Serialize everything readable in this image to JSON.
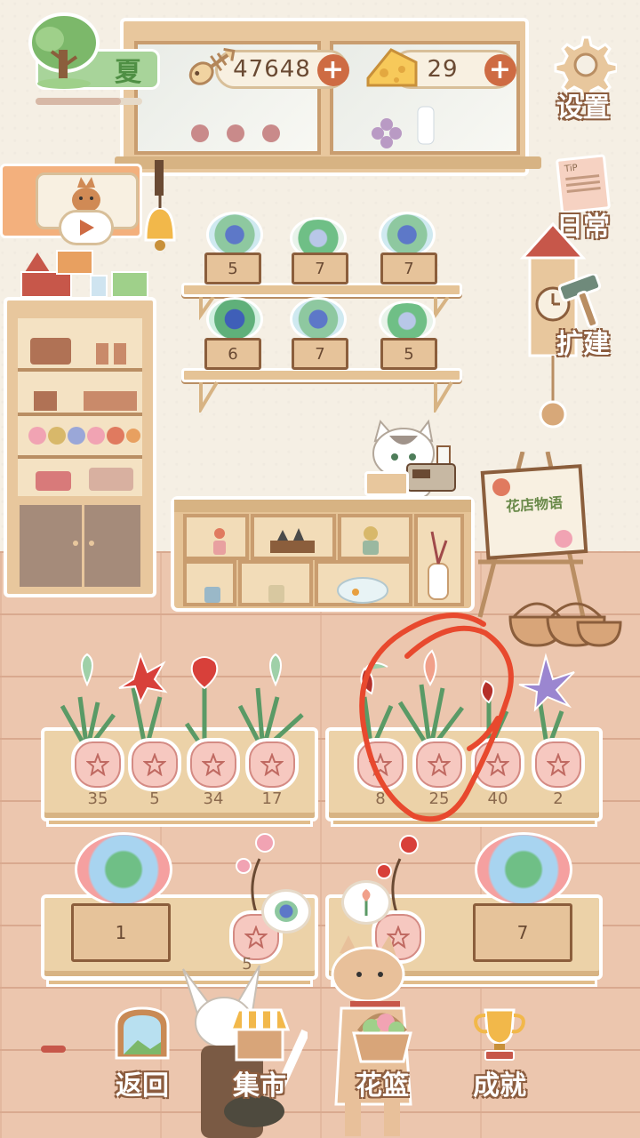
{
  "top_bar": {
    "season_label": "夏",
    "season_progress": 0.8,
    "fish_count": "47648",
    "cheese_count": "29",
    "fish_plus": "+",
    "cheese_plus": "+"
  },
  "right_menu": {
    "settings_label": "设置",
    "daily_label": "日常",
    "daily_note": "TiP",
    "expand_label": "扩建"
  },
  "shelves": {
    "top_row_counts": [
      "5",
      "7",
      "7"
    ],
    "bottom_row_counts": [
      "6",
      "7",
      "5"
    ]
  },
  "easel": {
    "sign": "花店物语"
  },
  "left_tables": {
    "pot_counts": [
      "35",
      "5",
      "34",
      "17"
    ],
    "crate_count": "1",
    "small_pot_count": "5"
  },
  "right_tables": {
    "pot_counts": [
      "8",
      "25",
      "40",
      "2"
    ],
    "crate_count": "7"
  },
  "bottom_nav": {
    "back_label": "返回",
    "market_label": "集市",
    "basket_label": "花篮",
    "achievement_label": "成就"
  },
  "colors": {
    "accent": "#ce6b43",
    "annotation_circle": "#e8492e",
    "season_green": "#a8d49a"
  }
}
